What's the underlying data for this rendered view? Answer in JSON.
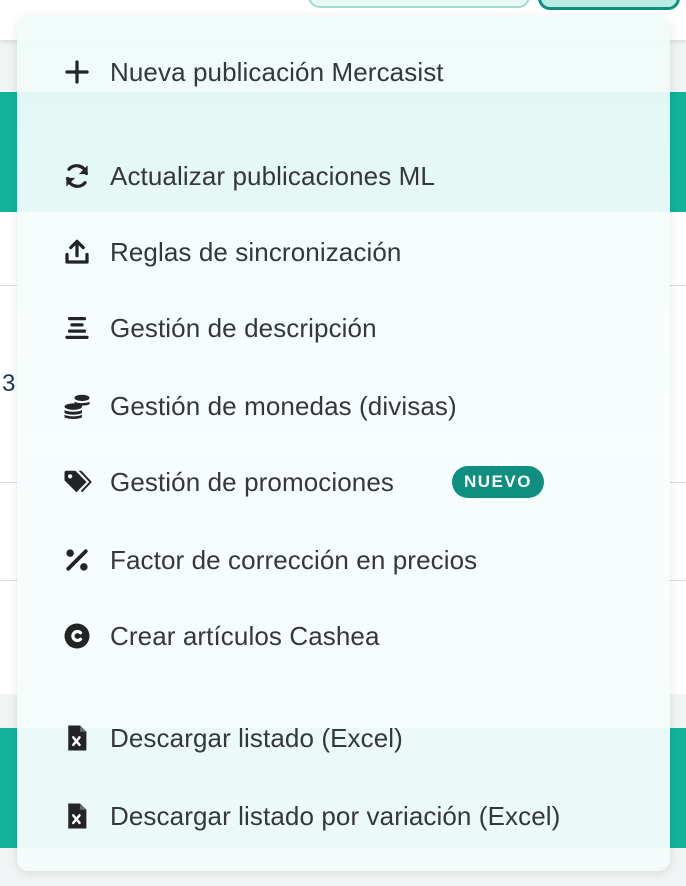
{
  "menu": {
    "items": [
      {
        "id": "new",
        "label": "Nueva publicación Mercasist",
        "icon": "plus-icon"
      },
      {
        "id": "refresh",
        "label": "Actualizar publicaciones ML",
        "icon": "refresh-icon"
      },
      {
        "id": "sync",
        "label": "Reglas de sincronización",
        "icon": "upload-icon"
      },
      {
        "id": "desc",
        "label": "Gestión de descripción",
        "icon": "align-center-icon"
      },
      {
        "id": "currency",
        "label": "Gestión de monedas (divisas)",
        "icon": "coins-icon"
      },
      {
        "id": "promos",
        "label": "Gestión de promociones",
        "icon": "tags-icon",
        "badge": "NUEVO"
      },
      {
        "id": "factor",
        "label": "Factor de corrección en precios",
        "icon": "percent-icon"
      },
      {
        "id": "cashea",
        "label": "Crear artículos Cashea",
        "icon": "copyright-icon"
      },
      {
        "id": "download",
        "label": "Descargar listado (Excel)",
        "icon": "file-excel-icon"
      },
      {
        "id": "download-var",
        "label": "Descargar listado por variación (Excel)",
        "icon": "file-excel-icon"
      }
    ]
  },
  "background": {
    "edge_text": "3"
  },
  "colors": {
    "accent": "#14b29b",
    "badge": "#0f8f80",
    "text": "#34373b",
    "icon": "#222426"
  }
}
